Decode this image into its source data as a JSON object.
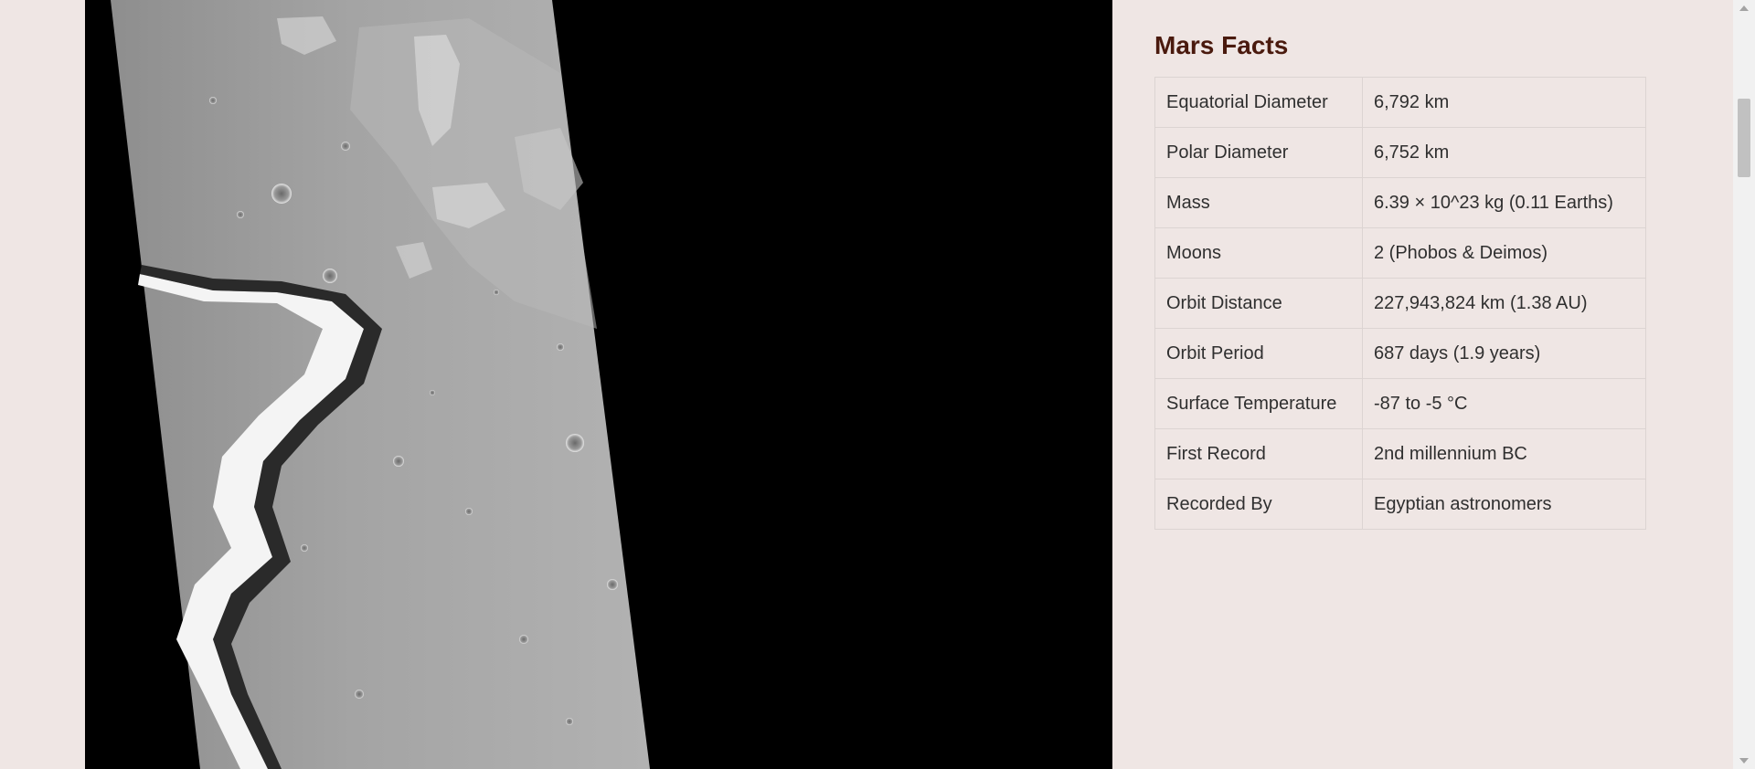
{
  "image": {
    "alt": "Mars"
  },
  "facts": {
    "title": "Mars Facts",
    "rows": [
      {
        "label": "Equatorial Diameter",
        "value": "6,792 km"
      },
      {
        "label": "Polar Diameter",
        "value": "6,752 km"
      },
      {
        "label": "Mass",
        "value": "6.39 × 10^23 kg (0.11 Earths)"
      },
      {
        "label": "Moons",
        "value": "2 (Phobos & Deimos)"
      },
      {
        "label": "Orbit Distance",
        "value": "227,943,824 km (1.38 AU)"
      },
      {
        "label": "Orbit Period",
        "value": "687 days (1.9 years)"
      },
      {
        "label": "Surface Temperature",
        "value": "-87 to -5 °C"
      },
      {
        "label": "First Record",
        "value": "2nd millennium BC"
      },
      {
        "label": "Recorded By",
        "value": "Egyptian astronomers"
      }
    ]
  },
  "colors": {
    "page_background": "#efe6e4",
    "title_color": "#4a1a0e",
    "image_background": "#000000"
  },
  "icons": {
    "scroll_up": "scroll-up-arrow-icon",
    "scroll_down": "scroll-down-arrow-icon"
  }
}
